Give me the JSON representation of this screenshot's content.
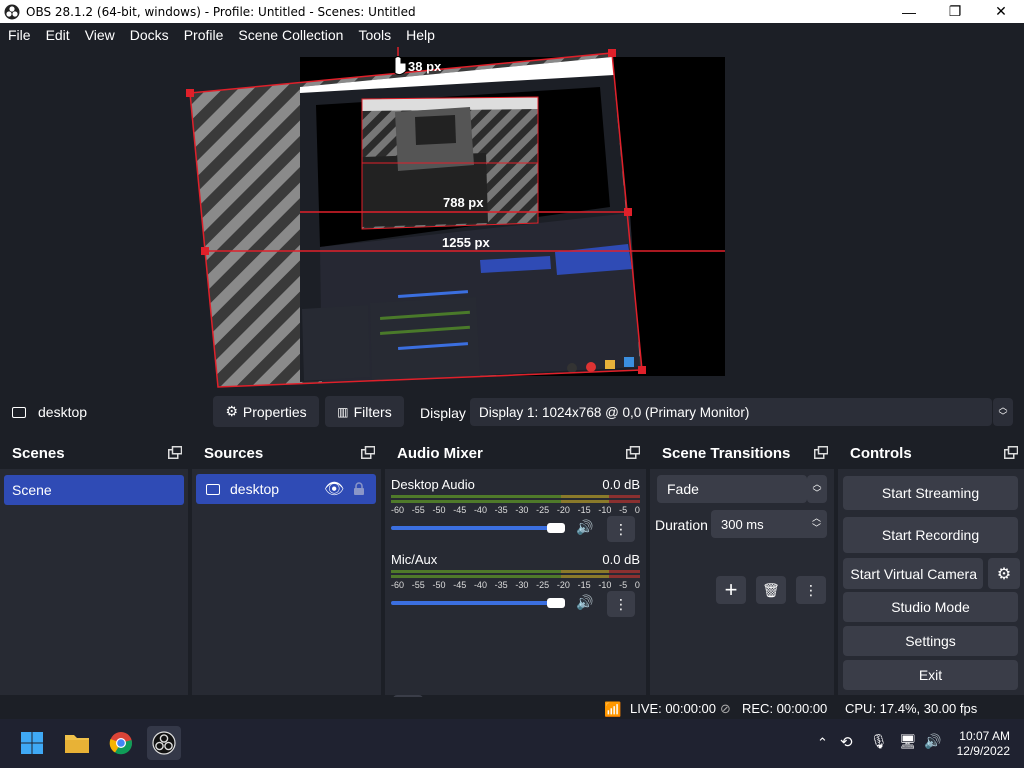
{
  "window": {
    "title": "OBS 28.1.2 (64-bit, windows) - Profile: Untitled - Scenes: Untitled",
    "controls": [
      "—",
      "❐",
      "✕"
    ]
  },
  "menu": [
    "File",
    "Edit",
    "View",
    "Docks",
    "Profile",
    "Scene Collection",
    "Tools",
    "Help"
  ],
  "preview": {
    "measure_top": "38 px",
    "measure_inner": "788 px",
    "measure_outer": "1255 px",
    "nested_texts": [
      "Scene Transitions",
      "Audio Mixer",
      "Sources",
      "Scenes",
      "Fade",
      "Duration",
      "300 ms",
      "Desktop Audio",
      "Mic/Aux",
      "desktop",
      "Scene"
    ]
  },
  "source_toolbar": {
    "source_name": "desktop",
    "properties_label": "Properties",
    "filters_label": "Filters",
    "display_label": "Display",
    "display_value": "Display 1: 1024x768 @ 0,0 (Primary Monitor)"
  },
  "scenes": {
    "title": "Scenes",
    "items": [
      "Scene"
    ]
  },
  "sources": {
    "title": "Sources",
    "items": [
      "desktop"
    ]
  },
  "audio_mixer": {
    "title": "Audio Mixer",
    "channels": [
      {
        "name": "Desktop Audio",
        "db": "0.0 dB",
        "volume_fraction": 1.0
      },
      {
        "name": "Mic/Aux",
        "db": "0.0 dB",
        "volume_fraction": 1.0
      }
    ],
    "scale": [
      "-60",
      "-55",
      "-50",
      "-45",
      "-40",
      "-35",
      "-30",
      "-25",
      "-20",
      "-15",
      "-10",
      "-5",
      "0"
    ]
  },
  "transitions": {
    "title": "Scene Transitions",
    "selected": "Fade",
    "duration_label": "Duration",
    "duration_value": "300 ms"
  },
  "controls": {
    "title": "Controls",
    "start_streaming": "Start Streaming",
    "start_recording": "Start Recording",
    "start_virtual_camera": "Start Virtual Camera",
    "studio_mode": "Studio Mode",
    "settings": "Settings",
    "exit": "Exit"
  },
  "status": {
    "live": "LIVE: 00:00:00",
    "rec": "REC: 00:00:00",
    "cpu": "CPU: 17.4%, 30.00 fps"
  },
  "taskbar": {
    "time": "10:07 AM",
    "date": "12/9/2022"
  },
  "colors": {
    "accent": "#2f4bb5",
    "selection_red": "#e0202a",
    "slider_blue": "#3b6fe0",
    "dock_bg": "#272a33",
    "app_bg": "#1c1f26"
  }
}
